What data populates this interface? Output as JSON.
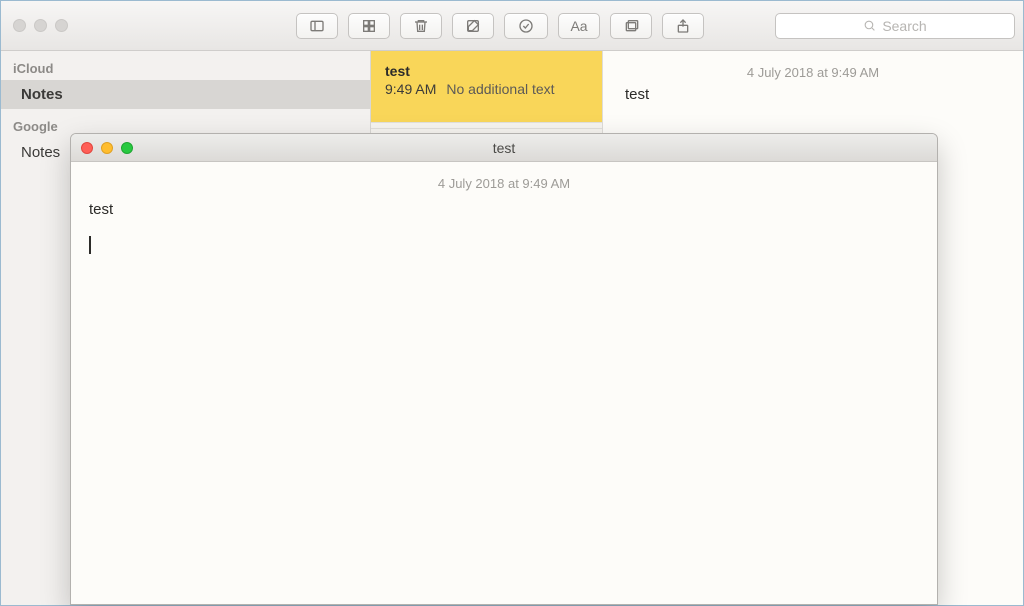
{
  "toolbar": {
    "search_placeholder": "Search"
  },
  "sidebar": {
    "sections": [
      {
        "title": "iCloud",
        "items": [
          {
            "label": "Notes",
            "selected": true
          }
        ]
      },
      {
        "title": "Google",
        "items": [
          {
            "label": "Notes",
            "selected": false
          }
        ]
      }
    ]
  },
  "note_list": [
    {
      "title": "test",
      "time": "9:49 AM",
      "preview": "No additional text",
      "selected": true
    }
  ],
  "editor": {
    "date": "4 July 2018 at 9:49 AM",
    "text": "test"
  },
  "float_window": {
    "title": "test",
    "date": "4 July 2018 at 9:49 AM",
    "text": "test"
  }
}
